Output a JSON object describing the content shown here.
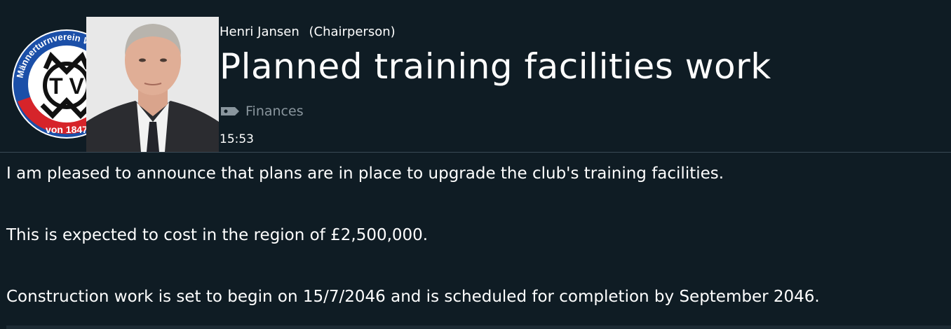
{
  "header": {
    "sender_name": "Henri Jansen",
    "sender_role": "(Chairperson)",
    "title": "Planned training facilities work",
    "category": "Finances",
    "category_icon": "tag-icon",
    "time": "15:53"
  },
  "crest": {
    "ring_text": "Männerturnverein Wolfenbüttel e.V.",
    "founded_text": "von 1847",
    "initials": "MTV",
    "colors": {
      "ring": "#1b4fa8",
      "band": "#d6242a",
      "inner": "#ffffff",
      "letters": "#111111"
    }
  },
  "body": {
    "paragraphs": [
      "I am pleased to announce that plans are in place to upgrade the club's training facilities.",
      "This is expected to cost in the region of £2,500,000.",
      "Construction work is set to begin on 15/7/2046 and is scheduled for completion by September 2046."
    ]
  },
  "colors": {
    "background": "#0f1c24",
    "divider": "#3a4a55",
    "muted_text": "#8a969e",
    "text": "#ffffff"
  }
}
